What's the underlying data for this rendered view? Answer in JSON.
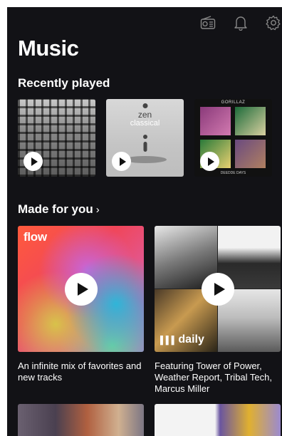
{
  "header": {
    "title": "Music",
    "icons": [
      "radio-icon",
      "bell-icon",
      "gear-icon"
    ]
  },
  "recently_played": {
    "title": "Recently played",
    "items": [
      {
        "name": "led-zeppelin-physical-graffiti",
        "cover_text": []
      },
      {
        "name": "zen-classical",
        "cover_text": [
          "zen",
          "classical"
        ]
      },
      {
        "name": "gorillaz-demon-days",
        "cover_text": [
          "GORILLAZ",
          "DEEDDE DAYS"
        ]
      }
    ]
  },
  "made_for_you": {
    "title": "Made for you",
    "chevron": "›",
    "items": [
      {
        "label": "flow",
        "caption": "An infinite mix of favorites and new tracks"
      },
      {
        "label": "daily",
        "caption": "Featuring Tower of Power, Weather Report, Tribal Tech, Marcus Miller"
      }
    ]
  },
  "colors": {
    "background": "#121216",
    "text": "#ffffff"
  }
}
